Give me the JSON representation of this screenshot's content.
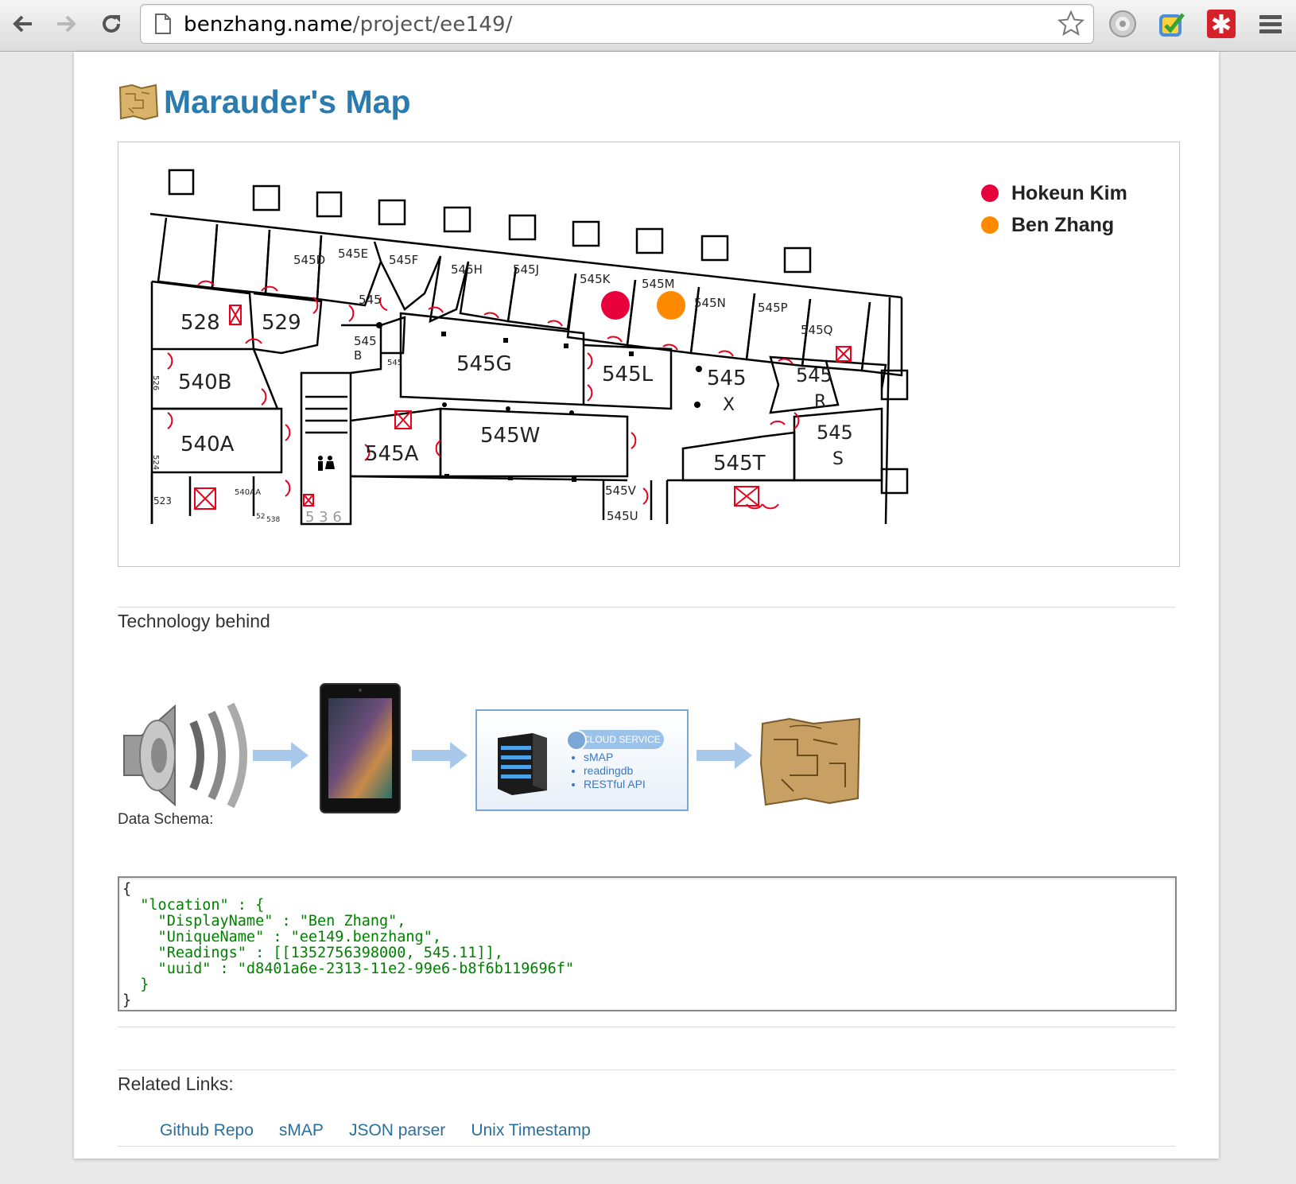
{
  "browser": {
    "url_host": "benzhang.name",
    "url_path": "/project/ee149/"
  },
  "page": {
    "title": "Marauder's Map",
    "floorplan": {
      "rooms": [
        "545D",
        "545E",
        "545F",
        "545H",
        "545J",
        "545K",
        "545M",
        "545N",
        "545P",
        "545Q",
        "545",
        "528",
        "529",
        "545 B",
        "545 C",
        "545G",
        "545L",
        "545 X",
        "545 R",
        "540B",
        "540A",
        "545A",
        "545W",
        "545 S",
        "545T",
        "545V",
        "545U",
        "526",
        "524",
        "523",
        "540AA",
        "536",
        "538",
        "52"
      ]
    },
    "legend": [
      {
        "name": "Hokeun Kim",
        "color": "#e8003c"
      },
      {
        "name": "Ben Zhang",
        "color": "#ff8a00"
      }
    ],
    "tech_heading": "Technology behind",
    "cloud": {
      "label": "CLOUD SERVICE",
      "items": [
        "sMAP",
        "readingdb",
        "RESTful API"
      ]
    },
    "schema_heading": "Data Schema:",
    "schema_lines": [
      "{",
      "  \"location\" : {",
      "    \"DisplayName\" : \"Ben Zhang\",",
      "    \"UniqueName\" : \"ee149.benzhang\",",
      "    \"Readings\" : [[1352756398000, 545.11]],",
      "    \"uuid\" : \"d8401a6e-2313-11e2-99e6-b8f6b119696f\"",
      "  }",
      "}"
    ],
    "links_heading": "Related Links:",
    "links": [
      "Github Repo",
      "sMAP",
      "JSON parser",
      "Unix Timestamp"
    ]
  },
  "colors": {
    "title": "#2a7bb0",
    "link": "#2a6f9e",
    "code": "#008000"
  }
}
